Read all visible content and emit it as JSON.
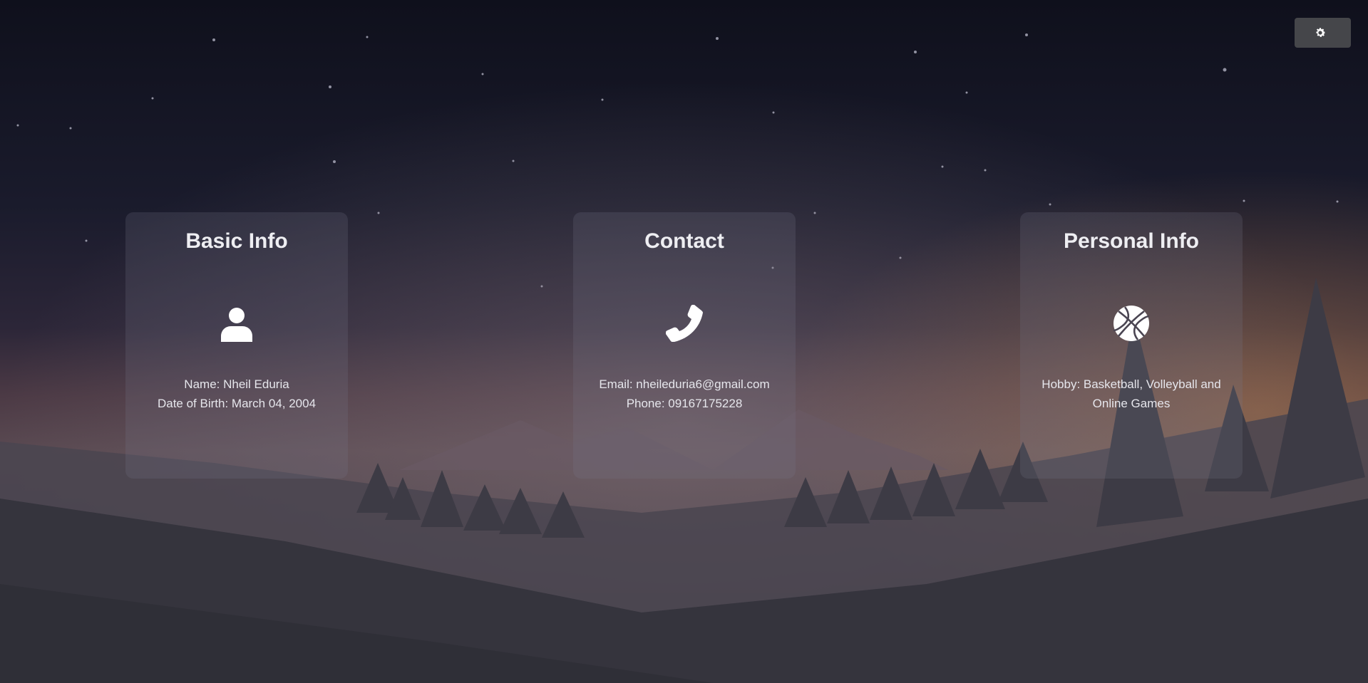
{
  "theme_toggle": {
    "icon": "gear-icon"
  },
  "cards": [
    {
      "title": "Basic Info",
      "icon": "user-icon",
      "lines": [
        "Name: Nheil Eduria",
        "Date of Birth: March 04, 2004"
      ]
    },
    {
      "title": "Contact",
      "icon": "phone-icon",
      "lines": [
        "Email: nheileduria6@gmail.com",
        "Phone: 09167175228"
      ]
    },
    {
      "title": "Personal Info",
      "icon": "basketball-icon",
      "lines": [
        "Hobby: Basketball, Volleyball and Online Games"
      ]
    }
  ]
}
